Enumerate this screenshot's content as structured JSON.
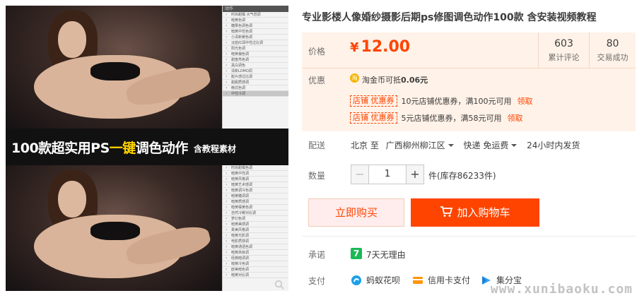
{
  "image": {
    "banner_pre": "100款超实用PS",
    "banner_highlight": "一键",
    "banner_post": "调色动作",
    "banner_sub": "含教程素材",
    "panel_header": "动作",
    "panel_rows_top": [
      "时尚甜橘 大气范调",
      "暗黄色调",
      "糖果色调色调",
      "暗黄中性色调",
      "小清新暖色调",
      "淡蓝红润中性过比调",
      "阳光色调",
      "暗黄偏色调",
      "甜蜜亮色调",
      "黑白调色",
      "清新LOMO调",
      "胶片感过比调",
      "甜甜质感调",
      "韩式色调",
      "中性冷调"
    ],
    "panel_rows_bottom": [
      "时尚甜橘色调",
      "暗黄中性调",
      "暗黄风格调",
      "暗黄艺术感调",
      "暗黄调冷色调",
      "暗黄糖调调",
      "暗黄质感调",
      "暗黄橘黄色调",
      "自然冷暖对比调",
      "梦幻色调",
      "暗黄美感调",
      "柔美风格调",
      "暗黄光影调",
      "电影质感调",
      "暗黄通透色调",
      "暗黄高级调",
      "经典暗调调",
      "暗黄冷色调",
      "欧美暗色调",
      "暗黄对比调"
    ],
    "panel_selected_index": 14
  },
  "title": "专业影楼人像婚纱摄影后期ps修图调色动作100款 含安装视频教程",
  "price": {
    "label": "价格",
    "currency": "¥",
    "value": "12.00"
  },
  "stats": [
    {
      "num": "603",
      "label": "累计评论"
    },
    {
      "num": "80",
      "label": "交易成功"
    }
  ],
  "promo": {
    "label": "优惠",
    "coin_icon": "淘",
    "coin_text": "淘金币可抵",
    "coin_value": "0.06元",
    "coupons": [
      {
        "tag": "店铺  优惠券",
        "text": "10元店铺优惠券，满100元可用",
        "link": "领取"
      },
      {
        "tag": "店铺  优惠券",
        "text": "5元店铺优惠券，满58元可用",
        "link": "领取"
      }
    ]
  },
  "delivery": {
    "label": "配送",
    "from": "北京 至",
    "to": "广西柳州柳江区",
    "shipping": "快递 免运费",
    "time": "24小时内发货"
  },
  "quantity": {
    "label": "数量",
    "minus": "−",
    "value": "1",
    "plus": "+",
    "stock": "件(库存86233件)"
  },
  "buttons": {
    "buy": "立即购买",
    "cart": "加入购物车"
  },
  "promise": {
    "label": "承诺",
    "icon": "7",
    "text": "7天无理由"
  },
  "payment": {
    "label": "支付",
    "methods": [
      {
        "name": "蚂蚁花呗",
        "icon": "huabei-icon",
        "color": "#1e9fe8"
      },
      {
        "name": "信用卡支付",
        "icon": "credit-card-icon",
        "color": "#ff9400"
      },
      {
        "name": "集分宝",
        "icon": "jifenbao-icon",
        "color": "#36a3f7"
      }
    ]
  },
  "watermark": "www.xunibaoku.com",
  "colors": {
    "accent": "#ff4400",
    "price_bg": "#fff2e8",
    "highlight_yellow": "#ffd400"
  }
}
